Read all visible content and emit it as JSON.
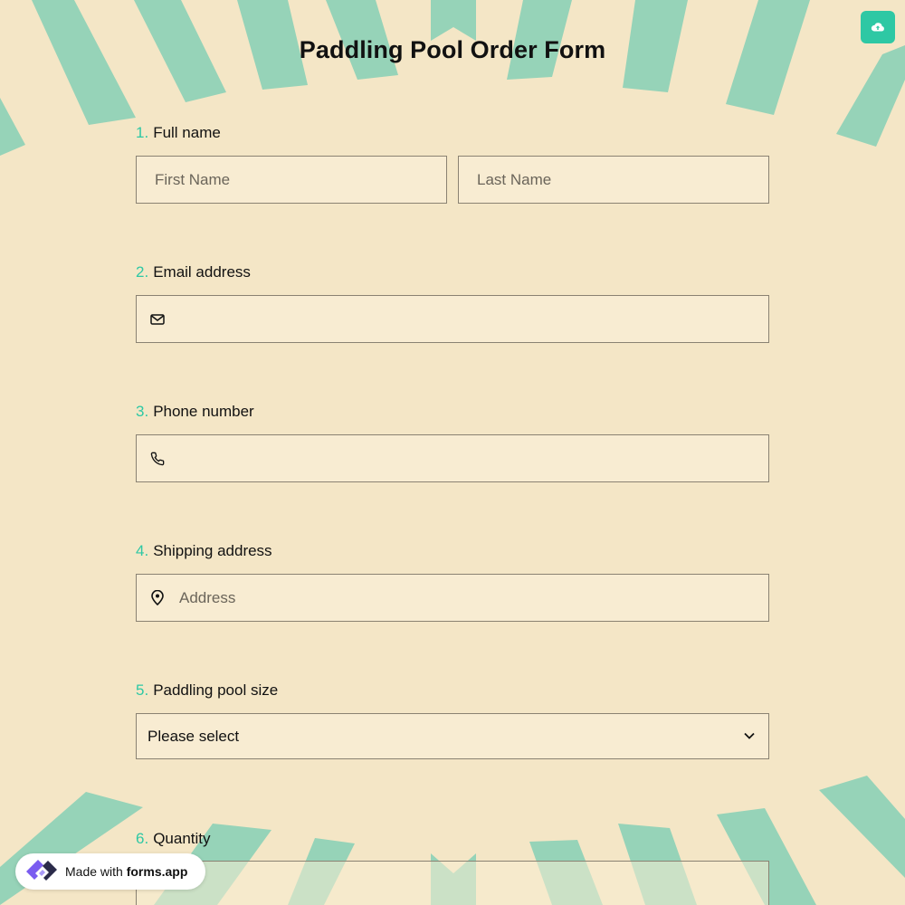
{
  "form": {
    "title": "Paddling Pool Order Form"
  },
  "upload_button": {
    "icon": "cloud-upload-icon"
  },
  "questions": {
    "q1": {
      "number": "1.",
      "label": "Full name",
      "first_placeholder": "First Name",
      "last_placeholder": "Last Name"
    },
    "q2": {
      "number": "2.",
      "label": "Email address",
      "icon": "envelope-icon"
    },
    "q3": {
      "number": "3.",
      "label": "Phone number",
      "icon": "phone-icon"
    },
    "q4": {
      "number": "4.",
      "label": "Shipping address",
      "icon": "map-pin-icon",
      "placeholder": "Address"
    },
    "q5": {
      "number": "5.",
      "label": "Paddling pool size",
      "selected": "Please select",
      "icon": "chevron-down-icon"
    },
    "q6": {
      "number": "6.",
      "label": "Quantity"
    }
  },
  "badge": {
    "prefix": "Made with",
    "brand": "forms.app"
  },
  "colors": {
    "background": "#f4e6c6",
    "accent": "#2ec8a4",
    "stripes": "#96d3b8",
    "field_bg": "#f8ecd2"
  }
}
